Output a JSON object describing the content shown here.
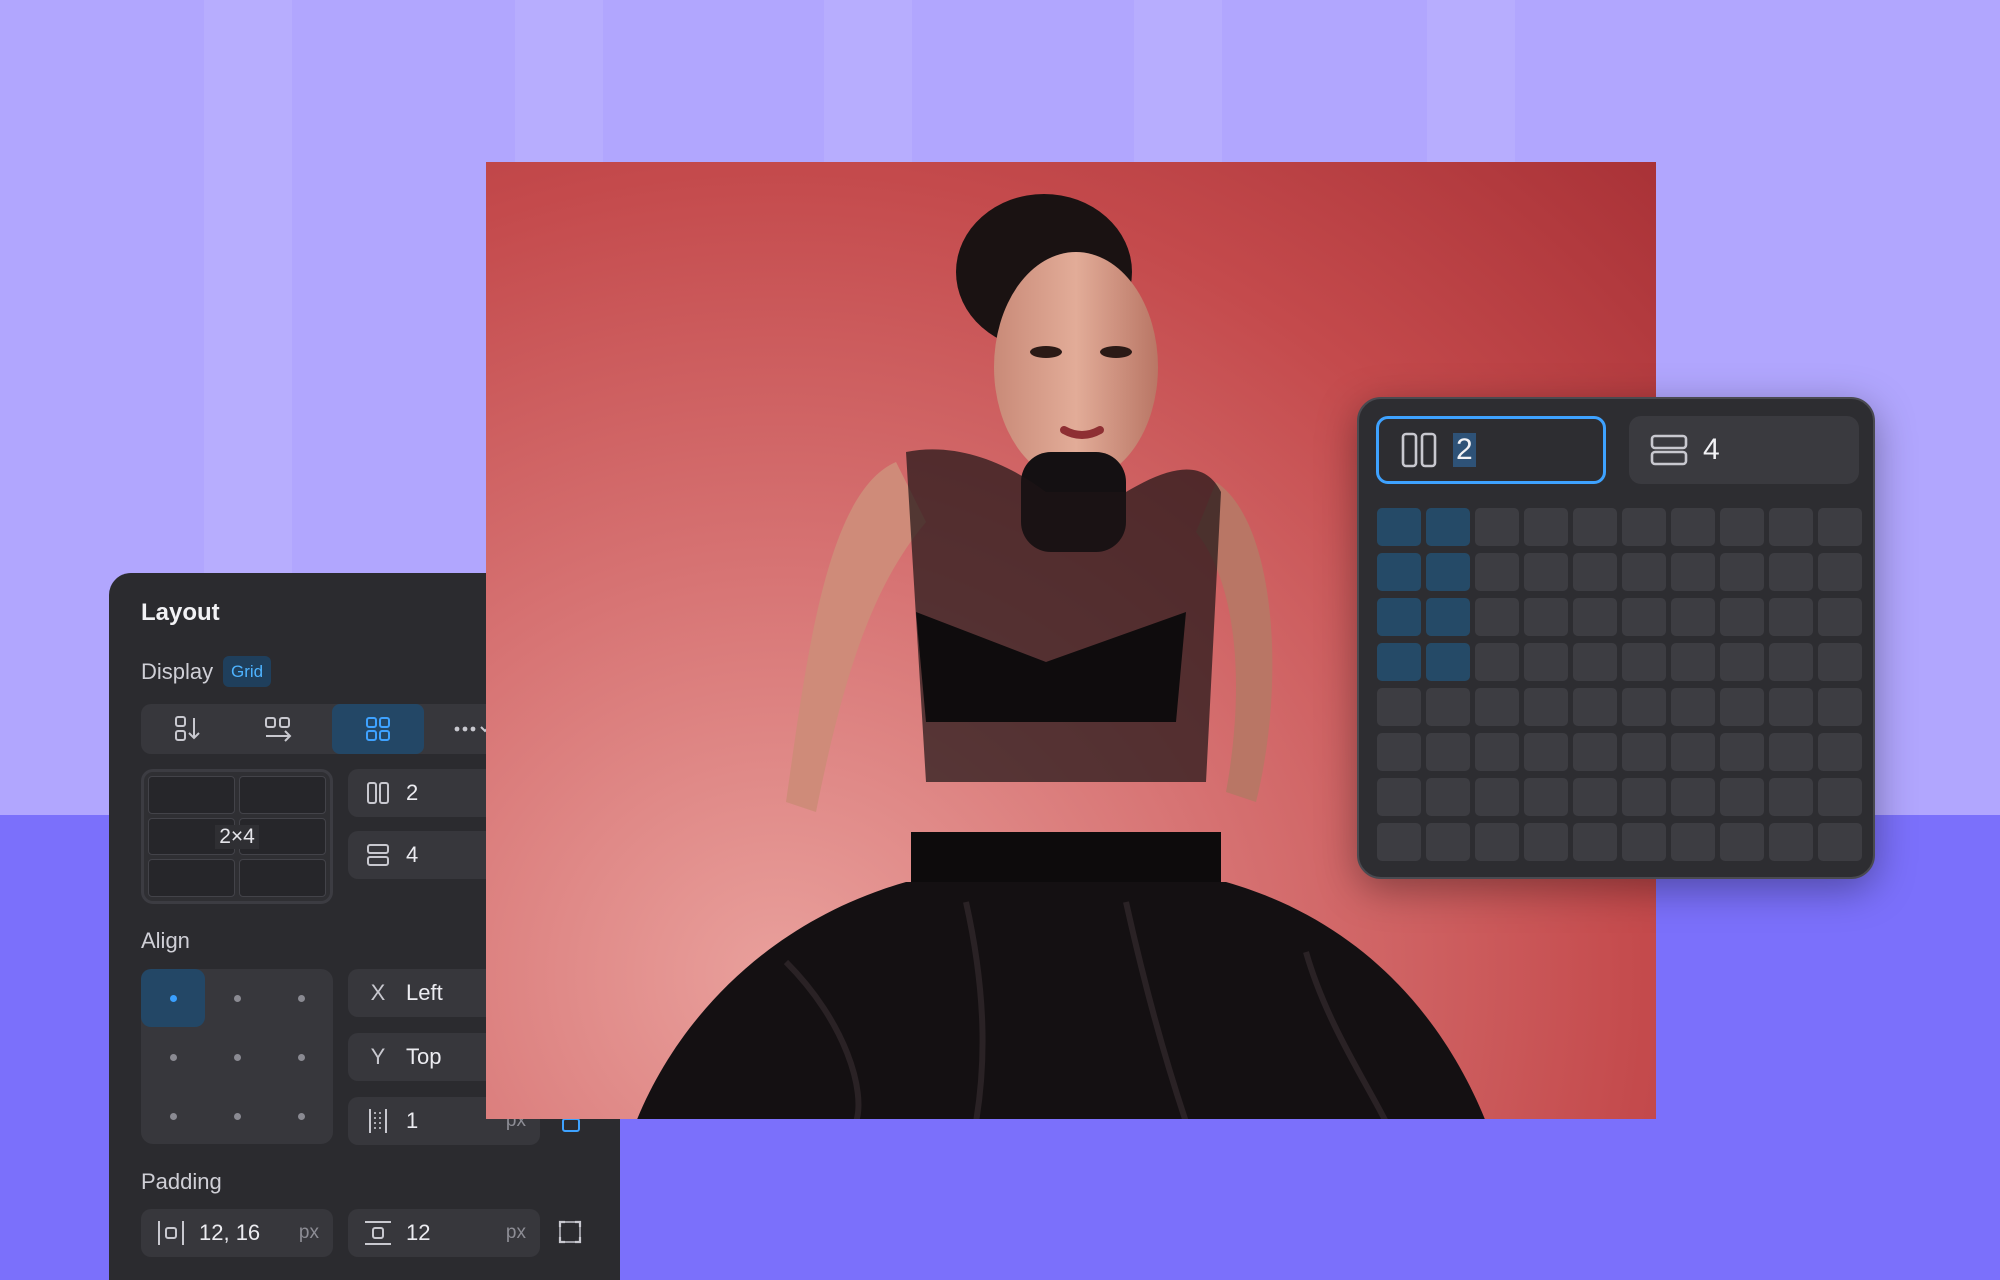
{
  "colors": {
    "accent": "#3ea2ff",
    "panel": "#2b2b2f",
    "selected_cell": "#254a67",
    "background_top": "#b1a6fe",
    "background_bottom": "#7b70fb"
  },
  "layout_panel": {
    "title": "Layout",
    "display": {
      "label": "Display",
      "badge": "Grid",
      "modes": [
        {
          "icon": "vertical-stack-icon",
          "active": false
        },
        {
          "icon": "horizontal-stack-icon",
          "active": false
        },
        {
          "icon": "grid-icon",
          "active": true
        },
        {
          "icon": "more-options-icon",
          "active": false
        }
      ]
    },
    "grid_preview": {
      "label": "2×4"
    },
    "columns": {
      "icon": "columns-icon",
      "value": "2"
    },
    "rows": {
      "icon": "rows-icon",
      "value": "4"
    },
    "align": {
      "label": "Align",
      "selected": "top-left",
      "x": {
        "icon_text": "X",
        "value": "Left"
      },
      "y": {
        "icon_text": "Y",
        "value": "Top"
      },
      "gap": {
        "icon": "gap-icon",
        "value": "1",
        "unit": "px"
      }
    },
    "padding": {
      "label": "Padding",
      "horizontal": {
        "icon": "padding-horizontal-icon",
        "value": "12, 16",
        "unit": "px"
      },
      "vertical": {
        "icon": "padding-vertical-icon",
        "value": "12",
        "unit": "px"
      }
    }
  },
  "grid_picker": {
    "columns": {
      "icon": "columns-icon",
      "value": "2",
      "focused": true
    },
    "rows": {
      "icon": "rows-icon",
      "value": "4",
      "focused": false
    },
    "grid_size": {
      "cols": 10,
      "rows": 8
    },
    "selection": {
      "cols": 2,
      "rows": 4
    }
  }
}
